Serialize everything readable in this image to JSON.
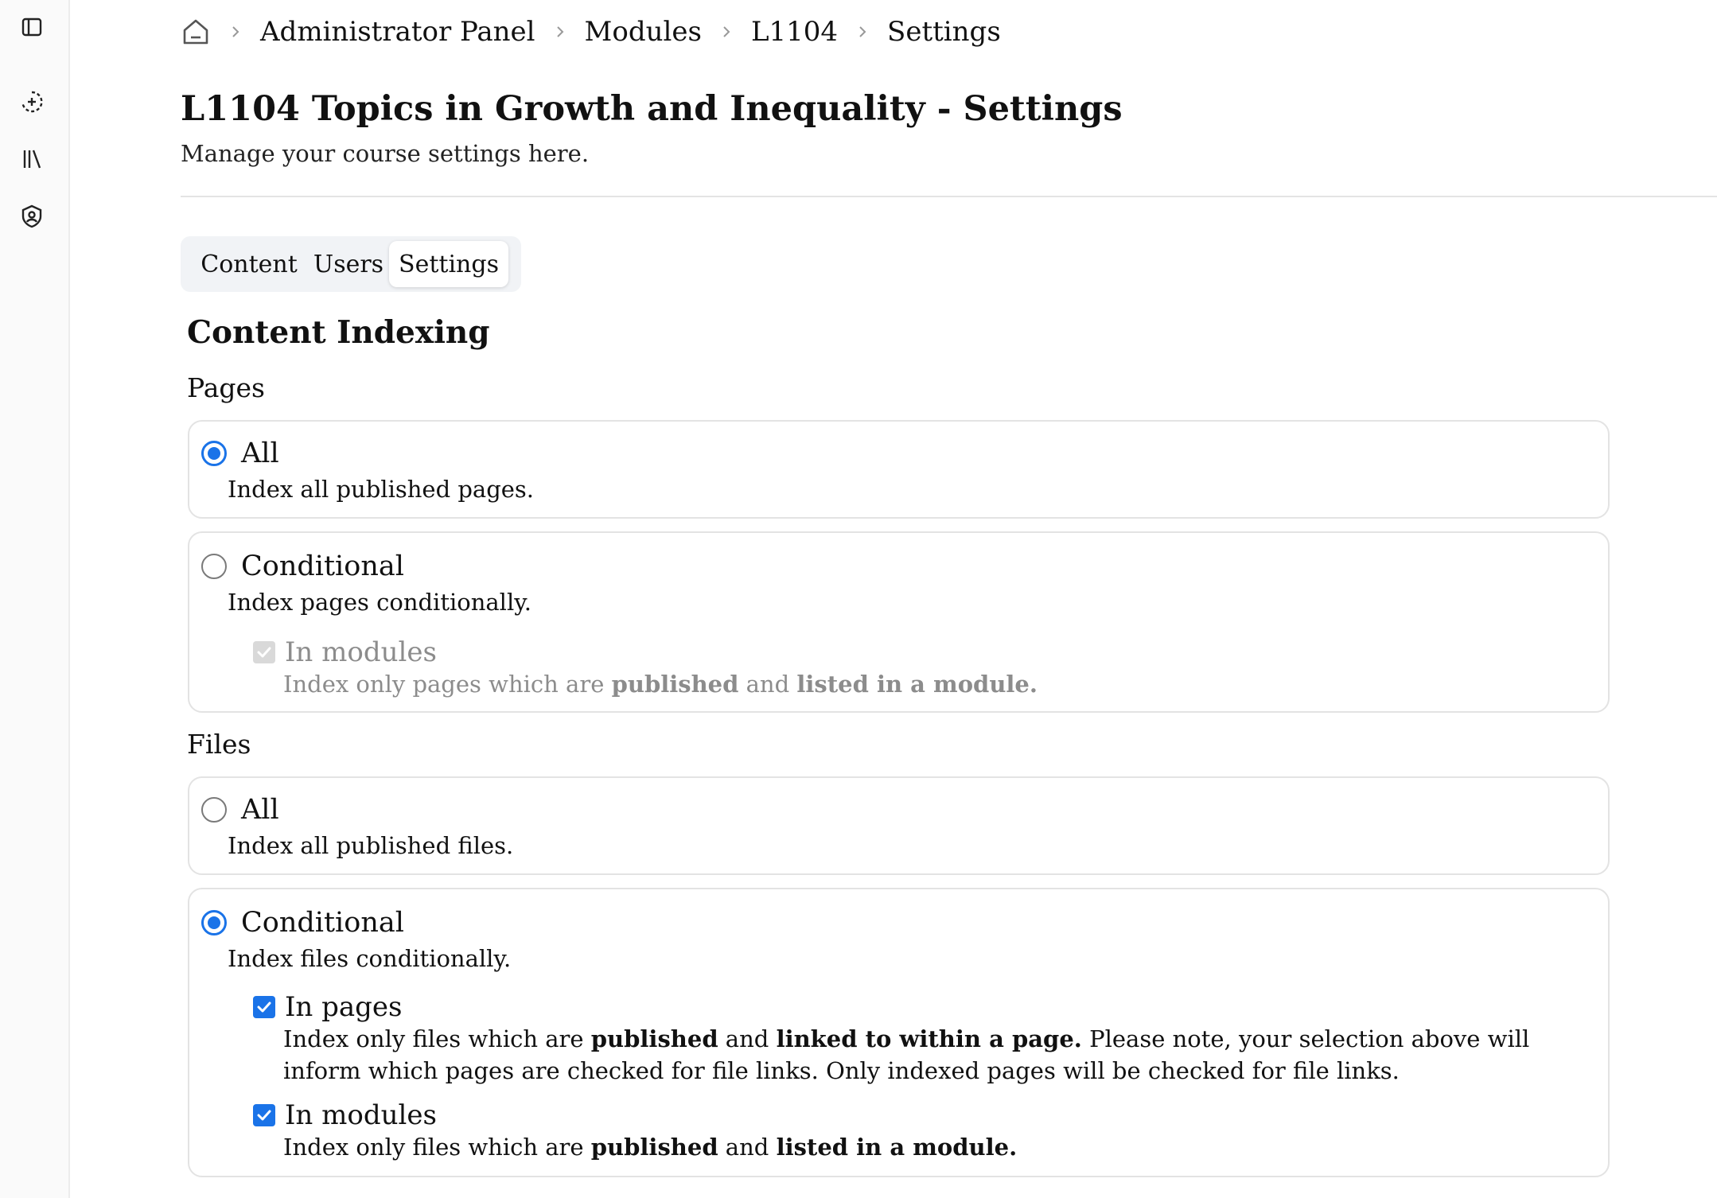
{
  "breadcrumb": {
    "home_icon": "home-icon",
    "items": [
      "Administrator Panel",
      "Modules",
      "L1104",
      "Settings"
    ]
  },
  "page": {
    "title": "L1104 Topics in Growth and Inequality - Settings",
    "subtitle": "Manage your course settings here."
  },
  "tabs": [
    {
      "label": "Content",
      "active": false
    },
    {
      "label": "Users",
      "active": false
    },
    {
      "label": "Settings",
      "active": true
    }
  ],
  "content_indexing": {
    "title": "Content Indexing",
    "pages": {
      "label": "Pages",
      "options": [
        {
          "label": "All",
          "description": "Index all published pages.",
          "selected": true
        },
        {
          "label": "Conditional",
          "description": "Index pages conditionally.",
          "selected": false,
          "checks": [
            {
              "label": "In modules",
              "checked": true,
              "disabled": true,
              "desc_parts": [
                "Index only pages which are ",
                "published",
                " and ",
                "listed in a module."
              ]
            }
          ]
        }
      ]
    },
    "files": {
      "label": "Files",
      "options": [
        {
          "label": "All",
          "description": "Index all published files.",
          "selected": false
        },
        {
          "label": "Conditional",
          "description": "Index files conditionally.",
          "selected": true,
          "checks": [
            {
              "label": "In pages",
              "checked": true,
              "disabled": false,
              "desc_parts": [
                "Index only files which are ",
                "published",
                " and ",
                "linked to within a page.",
                " Please note, your selection above will inform which pages are checked for file links. Only indexed pages will be checked for file links."
              ]
            },
            {
              "label": "In modules",
              "checked": true,
              "disabled": false,
              "desc_parts": [
                "Index only files which are ",
                "published",
                " and ",
                "listed in a module."
              ]
            }
          ]
        }
      ]
    }
  },
  "sidebar": {
    "icons": [
      "sidebar-toggle-icon",
      "new-chat-icon",
      "library-icon",
      "admin-shield-icon"
    ]
  },
  "colors": {
    "accent": "#1a73e8",
    "border": "#e3e3e3",
    "disabled": "#8c8c8c"
  }
}
